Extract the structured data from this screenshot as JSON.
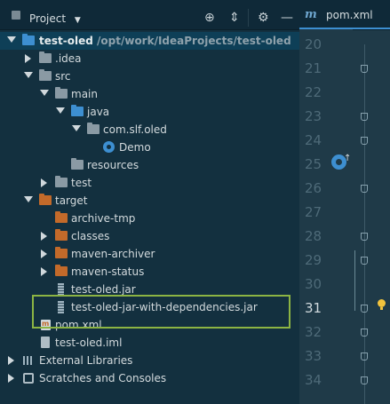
{
  "toolbar": {
    "title": "Project",
    "icons": [
      "target-icon",
      "collapse-icon",
      "gear-icon",
      "minimize-icon"
    ]
  },
  "tree": {
    "root_name": "test-oled",
    "root_path": "/opt/work/IdeaProjects/test-oled",
    "idea": ".idea",
    "src": "src",
    "main": "main",
    "java": "java",
    "package": "com.slf.oled",
    "demo": "Demo",
    "resources": "resources",
    "test": "test",
    "target": "target",
    "archive_tmp": "archive-tmp",
    "classes": "classes",
    "maven_archiver": "maven-archiver",
    "maven_status": "maven-status",
    "jar": "test-oled.jar",
    "jar_deps": "test-oled-jar-with-dependencies.jar",
    "pom": "pom.xml",
    "iml": "test-oled.iml",
    "external_libraries": "External Libraries",
    "scratches": "Scratches and Consoles"
  },
  "editor": {
    "tab_icon": "m",
    "tab_label": "pom.xml",
    "line_numbers": [
      "20",
      "21",
      "22",
      "23",
      "24",
      "25",
      "26",
      "27",
      "28",
      "29",
      "30",
      "31",
      "32",
      "33",
      "34"
    ],
    "current_line": "31"
  }
}
